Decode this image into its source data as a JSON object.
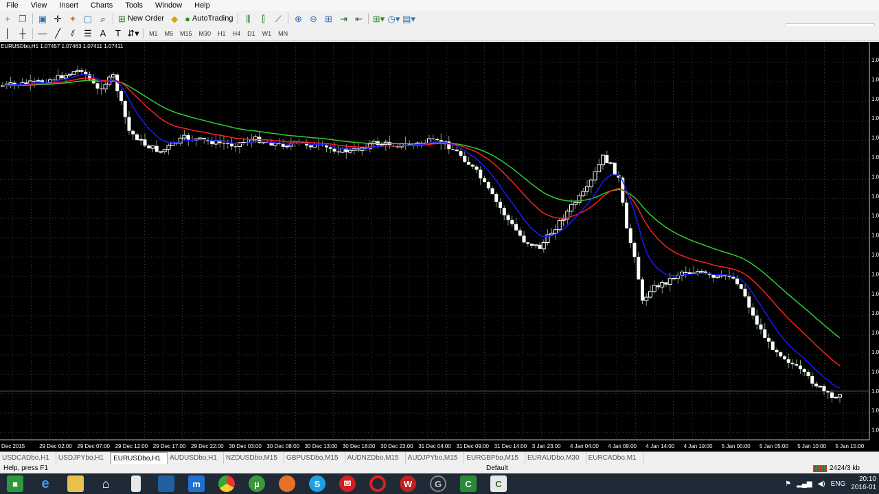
{
  "menu": [
    "File",
    "View",
    "Insert",
    "Charts",
    "Tools",
    "Window",
    "Help"
  ],
  "toolbar": {
    "new_order_label": "New Order",
    "autotrading_label": "AutoTrading",
    "timeframes": [
      "M1",
      "M5",
      "M15",
      "M30",
      "H1",
      "H4",
      "D1",
      "W1",
      "MN"
    ]
  },
  "chart": {
    "symbol_info": "EURUSDbo,H1  1.07457 1.07463 1.07411 1.07411",
    "price_axis_label": "1.0",
    "time_labels": [
      "Dec 2015",
      "29 Dec 02:00",
      "29 Dec 07:00",
      "29 Dec 12:00",
      "29 Dec 17:00",
      "29 Dec 22:00",
      "30 Dec 03:00",
      "30 Dec 08:00",
      "30 Dec 13:00",
      "30 Dec 18:00",
      "30 Dec 23:00",
      "31 Dec 04:00",
      "31 Dec 09:00",
      "31 Dec 14:00",
      "3 Jan 23:00",
      "4 Jan 04:00",
      "4 Jan 09:00",
      "4 Jan 14:00",
      "4 Jan 19:00",
      "5 Jan 00:00",
      "5 Jan 05:00",
      "5 Jan 10:00",
      "5 Jan 15:00"
    ],
    "colors": {
      "background": "#000000",
      "grid": "#3a3a3a",
      "bull": "#ffffff",
      "bear": "#ffffff",
      "wick": "#7fa07f",
      "ma_fast": "#1a1aff",
      "ma_mid": "#ff2020",
      "ma_slow": "#32cd32"
    }
  },
  "tabs": [
    "USDCADbo,H1",
    "USDJPYbo,H1",
    "EURUSDbo,H1",
    "AUDUSDbo,H1",
    "NZDUSDbo,M15",
    "GBPUSDbo,M15",
    "AUDNZDbo,M15",
    "AUDJPYbo,M15",
    "EURGBPbo,M15",
    "EURAUDbo,M30",
    "EURCADbo,M1"
  ],
  "active_tab": "EURUSDbo,H1",
  "status": {
    "help": "Help, press F1",
    "profile": "Default",
    "traffic": "2424/3 kb"
  },
  "taskbar": {
    "apps": [
      "start",
      "internet-explorer",
      "file-explorer",
      "home",
      "lenovo",
      "maxthon",
      "chrome",
      "utorrent",
      "firefox",
      "skype",
      "mail",
      "opera",
      "wps",
      "ubo-g",
      "camtasia",
      "camtasia-2"
    ],
    "language": "ENG",
    "time": "20:10",
    "date": "2016-01"
  }
}
